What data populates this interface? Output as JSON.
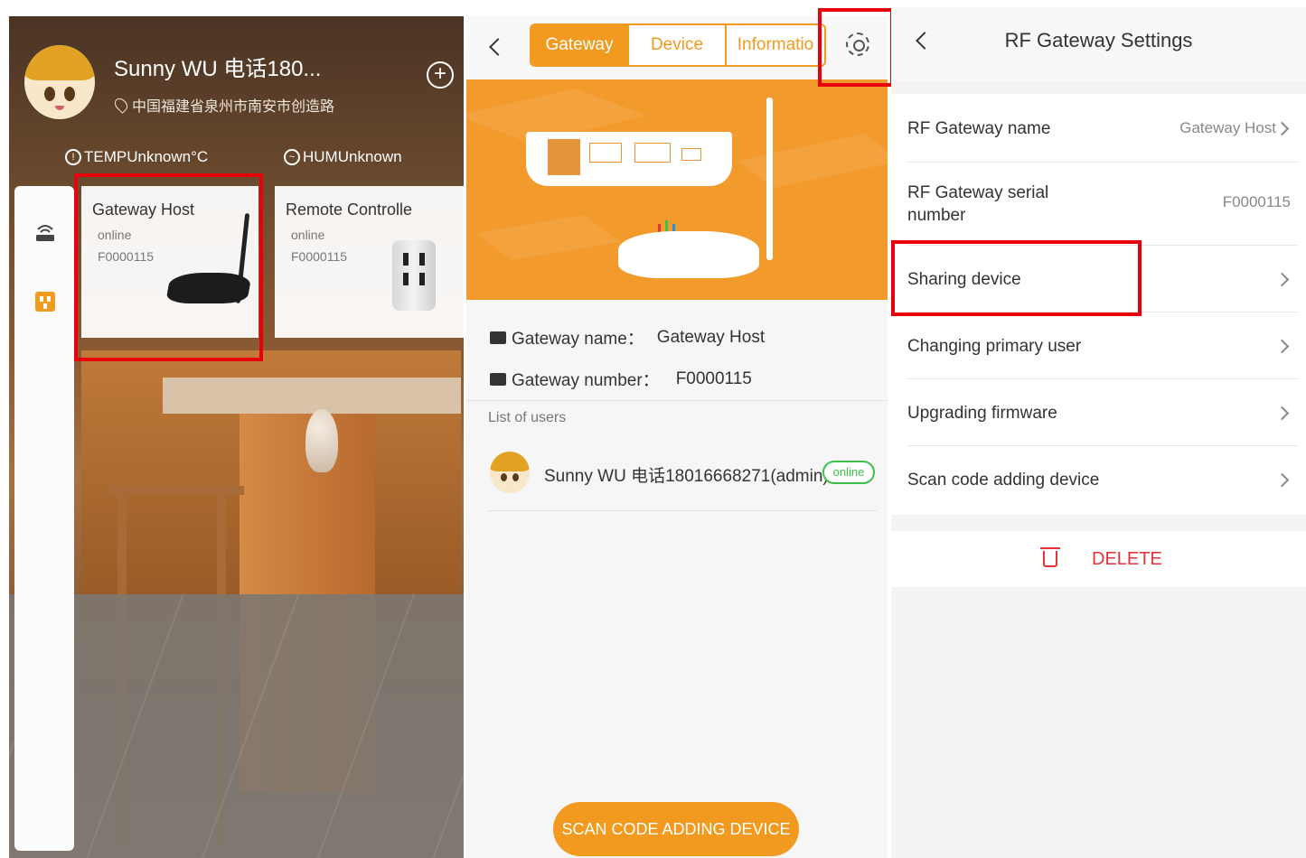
{
  "home": {
    "user_name": "Sunny WU 电话180...",
    "address": "中国福建省泉州市南安市创造路",
    "temp_label": "TEMPUnknown°C",
    "hum_label": "HUMUnknown",
    "cards": [
      {
        "name": "Gateway Host",
        "status": "online",
        "serial": "F0000115"
      },
      {
        "name": "Remote Controlle",
        "status": "online",
        "serial": "F0000115"
      }
    ]
  },
  "gateway": {
    "tabs": [
      {
        "label": "Gateway",
        "active": true
      },
      {
        "label": "Device",
        "active": false
      },
      {
        "label": "Informatio",
        "active": false
      }
    ],
    "name_label": "Gateway name：",
    "name_value": "Gateway Host",
    "number_label": "Gateway number：",
    "number_value": "F0000115",
    "list_label": "List of users",
    "users": [
      {
        "name": "Sunny WU 电话18016668271(admin)",
        "status": "online"
      }
    ],
    "scan_button": "SCAN CODE ADDING DEVICE",
    "banner_color": "#f39a2d",
    "accent": "#f29a1f"
  },
  "settings": {
    "title": "RF Gateway Settings",
    "rows": [
      {
        "label": "RF Gateway name",
        "value": "Gateway Host"
      },
      {
        "label": "RF Gateway serial number",
        "value": "F0000115"
      },
      {
        "label": "Sharing device",
        "value": ""
      },
      {
        "label": "Changing primary user",
        "value": ""
      },
      {
        "label": "Upgrading firmware",
        "value": ""
      },
      {
        "label": "Scan code adding device",
        "value": ""
      }
    ],
    "delete_label": "DELETE",
    "delete_color": "#e8323a"
  },
  "highlight_color": "#e8000b"
}
